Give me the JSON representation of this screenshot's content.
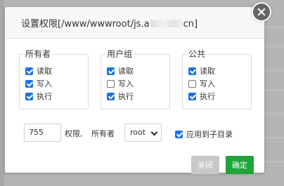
{
  "dialog": {
    "title_prefix": "设置权限[/www/wwwroot/js.a",
    "title_suffix": "cn]"
  },
  "groups": [
    {
      "legend": "所有者",
      "options": [
        {
          "label": "读取",
          "checked": true
        },
        {
          "label": "写入",
          "checked": true
        },
        {
          "label": "执行",
          "checked": true
        }
      ]
    },
    {
      "legend": "用户组",
      "options": [
        {
          "label": "读取",
          "checked": true
        },
        {
          "label": "写入",
          "checked": false
        },
        {
          "label": "执行",
          "checked": true
        }
      ]
    },
    {
      "legend": "公共",
      "options": [
        {
          "label": "读取",
          "checked": true
        },
        {
          "label": "写入",
          "checked": false
        },
        {
          "label": "执行",
          "checked": true
        }
      ]
    }
  ],
  "permission": {
    "value": "755",
    "label": "权限,"
  },
  "owner": {
    "label": "所有者",
    "selected": "root"
  },
  "apply_subdirs": {
    "label": "应用到子目录",
    "checked": true
  },
  "buttons": {
    "close_label": "关闭",
    "ok_label": "确定"
  },
  "colors": {
    "checkbox_accent": "#1a73e8",
    "ok_button": "#20a53a",
    "close_button_disabled": "#c8c8c8"
  }
}
